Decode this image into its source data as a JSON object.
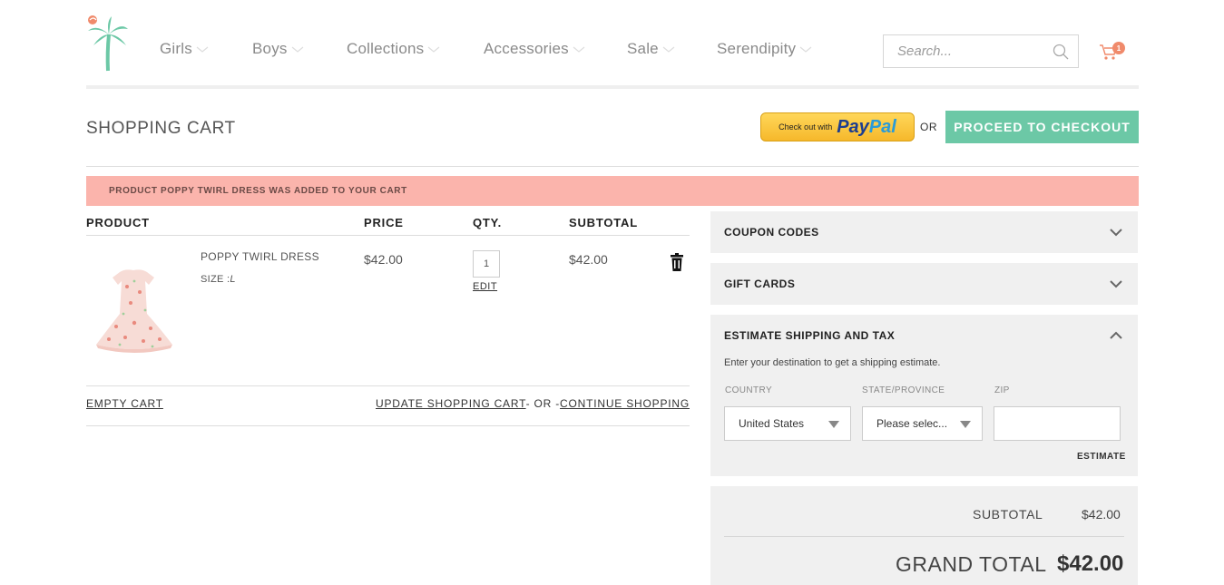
{
  "header": {
    "nav": [
      {
        "label": "Girls"
      },
      {
        "label": "Boys"
      },
      {
        "label": "Collections"
      },
      {
        "label": "Accessories"
      },
      {
        "label": "Sale"
      },
      {
        "label": "Serendipity"
      }
    ],
    "search_placeholder": "Search...",
    "cart_count": "1"
  },
  "page": {
    "title": "SHOPPING CART",
    "paypal_small": "Check out with",
    "paypal_pay": "Pay",
    "paypal_pal": "Pal",
    "or_label": "OR",
    "checkout_label": "PROCEED TO CHECKOUT"
  },
  "notice": "PRODUCT POPPY TWIRL DRESS WAS ADDED TO YOUR CART",
  "cart": {
    "headers": {
      "product": "PRODUCT",
      "price": "PRICE",
      "qty": "QTY.",
      "subtotal": "SUBTOTAL"
    },
    "items": [
      {
        "name": "POPPY TWIRL DRESS",
        "size_label": "SIZE :",
        "size_value": "L",
        "price": "$42.00",
        "qty": "1",
        "edit_label": "EDIT",
        "subtotal": "$42.00"
      }
    ],
    "empty_label": "EMPTY CART",
    "update_label": "UPDATE SHOPPING CART",
    "or_sep_left": "- OR -",
    "continue_label": "CONTINUE SHOPPING"
  },
  "sidebar": {
    "coupon_title": "COUPON CODES",
    "gift_title": "GIFT CARDS",
    "shipping": {
      "title": "ESTIMATE SHIPPING AND TAX",
      "description": "Enter your destination to get a shipping estimate.",
      "country_label": "COUNTRY",
      "country_value": "United States",
      "state_label": "STATE/PROVINCE",
      "state_value": "Please selec...",
      "zip_label": "ZIP",
      "zip_value": "",
      "estimate_label": "ESTIMATE"
    },
    "totals": {
      "subtotal_label": "SUBTOTAL",
      "subtotal_value": "$42.00",
      "grand_label": "GRAND TOTAL",
      "grand_value": "$42.00"
    }
  },
  "colors": {
    "accent": "#6cc8a6",
    "notice_bg": "#fbb4ac",
    "badge": "#f08a6b",
    "panel_bg": "#f0f0f0"
  }
}
